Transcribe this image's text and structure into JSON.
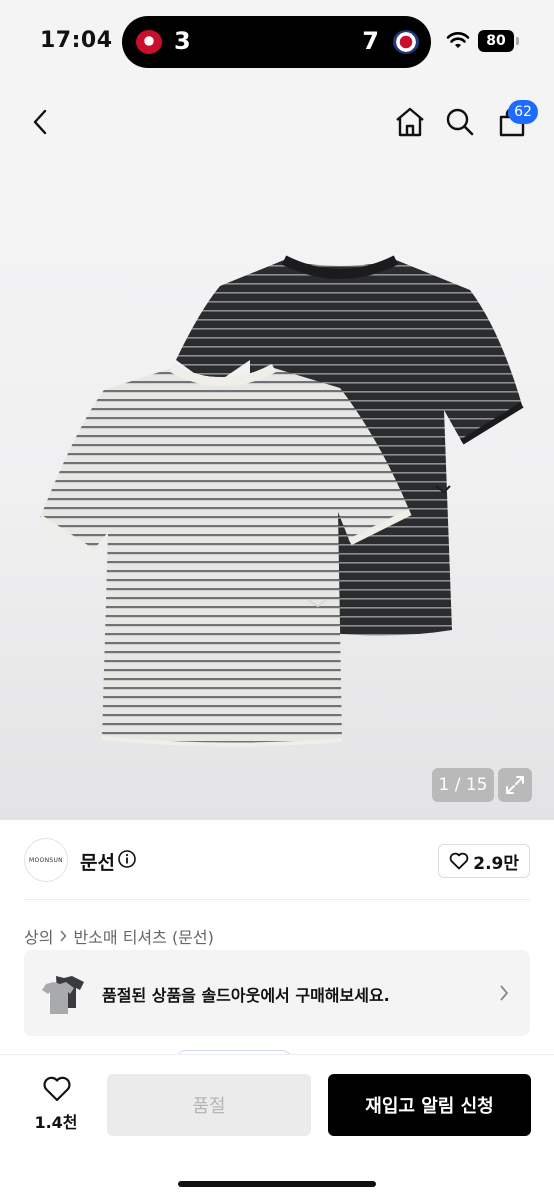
{
  "status_bar": {
    "time": "17:04",
    "score_home": "3",
    "score_away": "7",
    "battery": "80"
  },
  "nav": {
    "cart_count": "62"
  },
  "gallery": {
    "counter": "1 / 15"
  },
  "brand": {
    "logo_text": "MOONSUN",
    "name": "문선",
    "likes": "2.9만"
  },
  "breadcrumb": {
    "category": "상의",
    "subcategory": "반소매 티셔츠 (문선)"
  },
  "banner": {
    "text": "품절된 상품을 솔드아웃에서 구매해보세요."
  },
  "bottom_bar": {
    "wish_count": "1.4천",
    "soldout_label": "품절",
    "restock_label": "재입고 알림 신청"
  },
  "colors": {
    "accent": "#1f6bff",
    "primary_button": "#000000",
    "disabled_button": "#ebebeb"
  }
}
